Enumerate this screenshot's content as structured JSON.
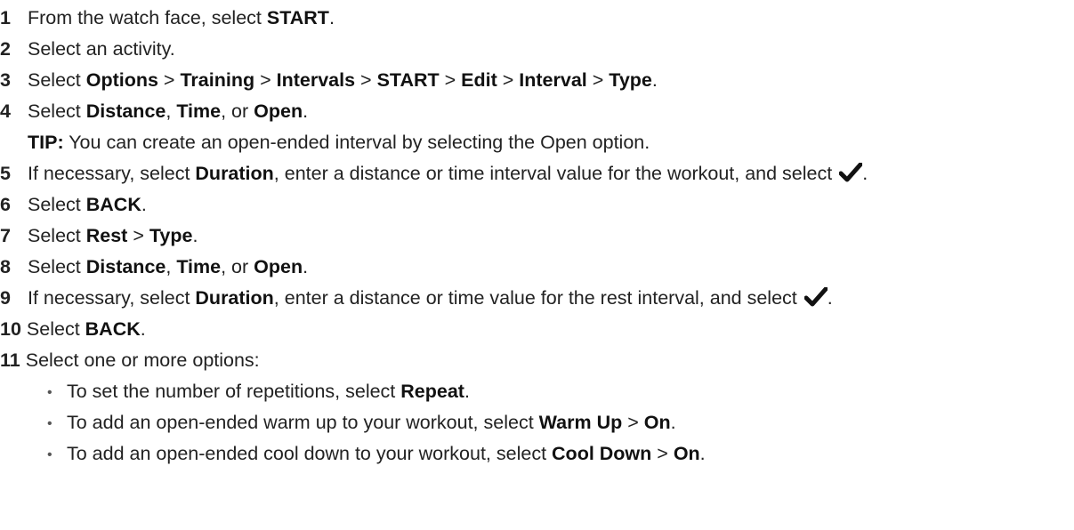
{
  "steps": [
    {
      "num": "1",
      "t1": "From the watch face, select ",
      "b1": "START",
      "t2": "."
    },
    {
      "num": "2",
      "t1": "Select an activity."
    },
    {
      "num": "3",
      "t1": "Select ",
      "b1": "Options",
      "t2": " > ",
      "b2": "Training",
      "t3": " > ",
      "b3": "Intervals",
      "t4": " > ",
      "b4": "START",
      "t5": " > ",
      "b5": "Edit",
      "t6": " > ",
      "b6": "Interval",
      "t7": " > ",
      "b7": "Type",
      "t8": "."
    },
    {
      "num": "4",
      "t1": "Select ",
      "b1": "Distance",
      "t2": ", ",
      "b2": "Time",
      "t3": ", or ",
      "b3": "Open",
      "t4": "."
    },
    {
      "num": "5",
      "t1": "If necessary, select ",
      "b1": "Duration",
      "t2": ", enter a distance or time interval value for the workout, and select ",
      "t3": "."
    },
    {
      "num": "6",
      "t1": "Select ",
      "b1": "BACK",
      "t2": "."
    },
    {
      "num": "7",
      "t1": "Select ",
      "b1": "Rest",
      "t2": " > ",
      "b2": "Type",
      "t3": "."
    },
    {
      "num": "8",
      "t1": "Select ",
      "b1": "Distance",
      "t2": ", ",
      "b2": "Time",
      "t3": ", or ",
      "b3": "Open",
      "t4": "."
    },
    {
      "num": "9",
      "t1": "If necessary, select ",
      "b1": "Duration",
      "t2": ", enter a distance or time value for the rest interval, and select ",
      "t3": "."
    },
    {
      "num": "10",
      "t1": "Select ",
      "b1": "BACK",
      "t2": "."
    },
    {
      "num": "11",
      "t1": "Select one or more options:"
    }
  ],
  "tip": {
    "label": "TIP:",
    "text": " You can create an open-ended interval by selecting the Open option."
  },
  "bullets": [
    {
      "t1": "To set the number of repetitions, select ",
      "b1": "Repeat",
      "t2": "."
    },
    {
      "t1": "To add an open-ended warm up to your workout, select ",
      "b1": "Warm Up",
      "t2": " > ",
      "b2": "On",
      "t3": "."
    },
    {
      "t1": "To add an open-ended cool down to your workout, select ",
      "b1": "Cool Down",
      "t2": " > ",
      "b2": "On",
      "t3": "."
    }
  ],
  "bullet_glyph": "•",
  "icons": {
    "confirm": "checkmark-icon"
  }
}
